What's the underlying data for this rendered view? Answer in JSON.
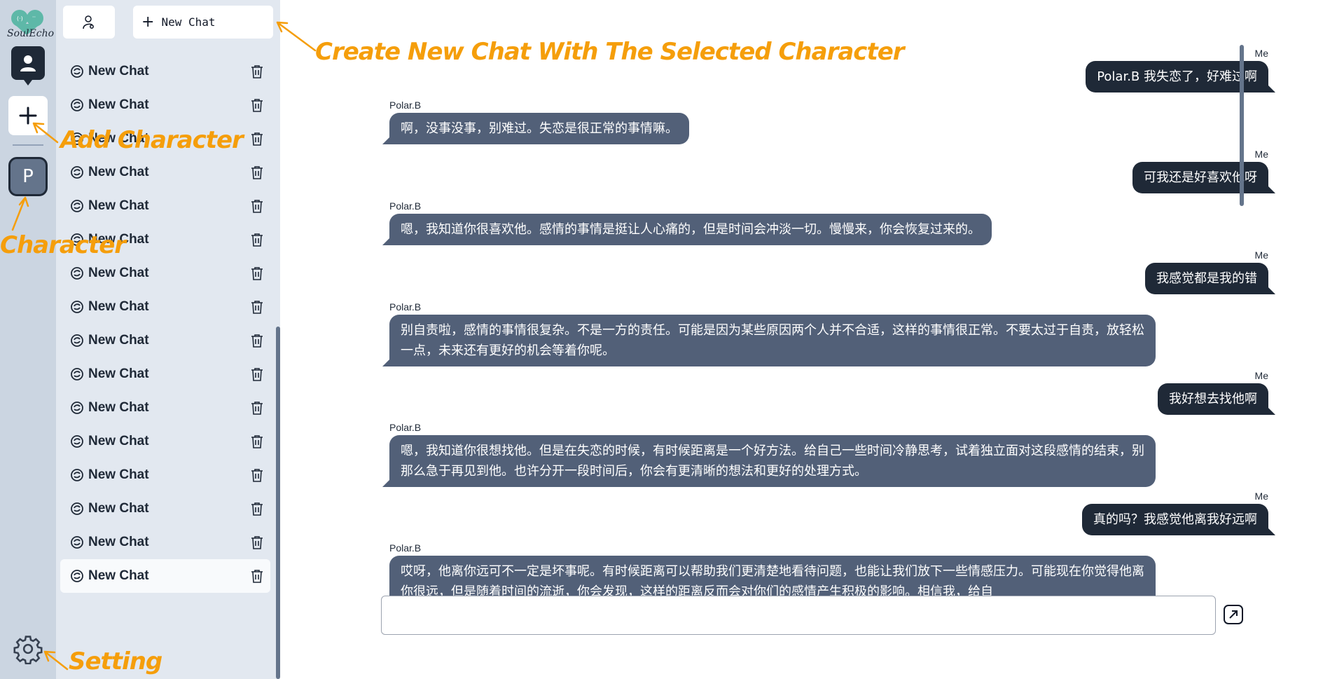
{
  "app": {
    "name": "SoulEcho"
  },
  "rail": {
    "character_initial": "P"
  },
  "panel": {
    "new_chat_label": "New Chat",
    "chats": [
      {
        "label": "New Chat"
      },
      {
        "label": "New Chat"
      },
      {
        "label": "New Chat"
      },
      {
        "label": "New Chat"
      },
      {
        "label": "New Chat"
      },
      {
        "label": "New Chat"
      },
      {
        "label": "New Chat"
      },
      {
        "label": "New Chat"
      },
      {
        "label": "New Chat"
      },
      {
        "label": "New Chat"
      },
      {
        "label": "New Chat"
      },
      {
        "label": "New Chat"
      },
      {
        "label": "New Chat"
      },
      {
        "label": "New Chat"
      },
      {
        "label": "New Chat"
      },
      {
        "label": "New Chat"
      }
    ]
  },
  "messages": [
    {
      "role": "me",
      "sender": "Me",
      "text": "Polar.B 我失恋了，好难过啊"
    },
    {
      "role": "bot",
      "sender": "Polar.B",
      "text": "啊，没事没事，别难过。失恋是很正常的事情嘛。"
    },
    {
      "role": "me",
      "sender": "Me",
      "text": "可我还是好喜欢他呀"
    },
    {
      "role": "bot",
      "sender": "Polar.B",
      "text": "嗯，我知道你很喜欢他。感情的事情是挺让人心痛的，但是时间会冲淡一切。慢慢来，你会恢复过来的。"
    },
    {
      "role": "me",
      "sender": "Me",
      "text": "我感觉都是我的错"
    },
    {
      "role": "bot",
      "sender": "Polar.B",
      "text": "别自责啦，感情的事情很复杂。不是一方的责任。可能是因为某些原因两个人并不合适，这样的事情很正常。不要太过于自责，放轻松一点，未来还有更好的机会等着你呢。"
    },
    {
      "role": "me",
      "sender": "Me",
      "text": "我好想去找他啊"
    },
    {
      "role": "bot",
      "sender": "Polar.B",
      "text": "嗯，我知道你很想找他。但是在失恋的时候，有时候距离是一个好方法。给自己一些时间冷静思考，试着独立面对这段感情的结束，别那么急于再见到他。也许分开一段时间后，你会有更清晰的想法和更好的处理方式。"
    },
    {
      "role": "me",
      "sender": "Me",
      "text": "真的吗？我感觉他离我好远啊"
    },
    {
      "role": "bot",
      "sender": "Polar.B",
      "text": "哎呀，他离你远可不一定是坏事呢。有时候距离可以帮助我们更清楚地看待问题，也能让我们放下一些情感压力。可能现在你觉得他离你很远，但是随着时间的流逝，你会发现，这样的距离反而会对你们的感情产生积极的影响。相信我，给自"
    }
  ],
  "input": {
    "value": ""
  },
  "annotations": {
    "create_new_chat": "Create New Chat With The Selected Character",
    "add_character": "Add Character",
    "character": "Character",
    "setting": "Setting"
  },
  "colors": {
    "accent": "#f59e0b",
    "me_bubble": "#1f2937",
    "bot_bubble": "#526078",
    "rail_bg": "#cbd5e1",
    "panel_bg": "#e2e8f0"
  }
}
